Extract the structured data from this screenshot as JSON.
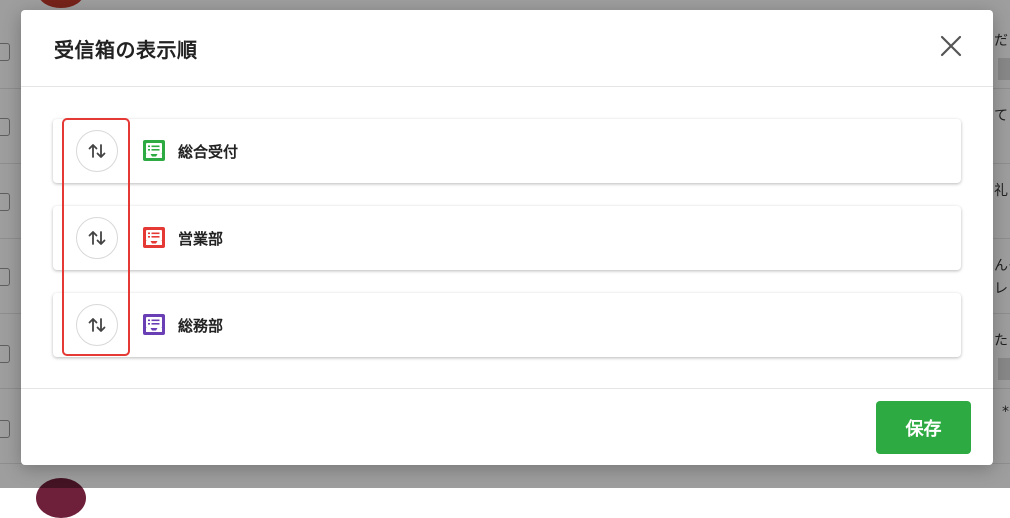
{
  "dialog": {
    "title": "受信箱の表示順",
    "save_label": "保存"
  },
  "inboxes": [
    {
      "label": "総合受付",
      "color": "#2eaa42",
      "icon": "inbox-icon"
    },
    {
      "label": "営業部",
      "color": "#e53935",
      "icon": "inbox-icon"
    },
    {
      "label": "総務部",
      "color": "#6a3fb5",
      "icon": "inbox-icon"
    }
  ],
  "background": {
    "snippets": [
      "だ",
      "て",
      "礼",
      "んそ",
      "レ",
      "た",
      "*"
    ]
  },
  "colors": {
    "highlight": "#e53935",
    "save_button": "#2eaa42"
  }
}
